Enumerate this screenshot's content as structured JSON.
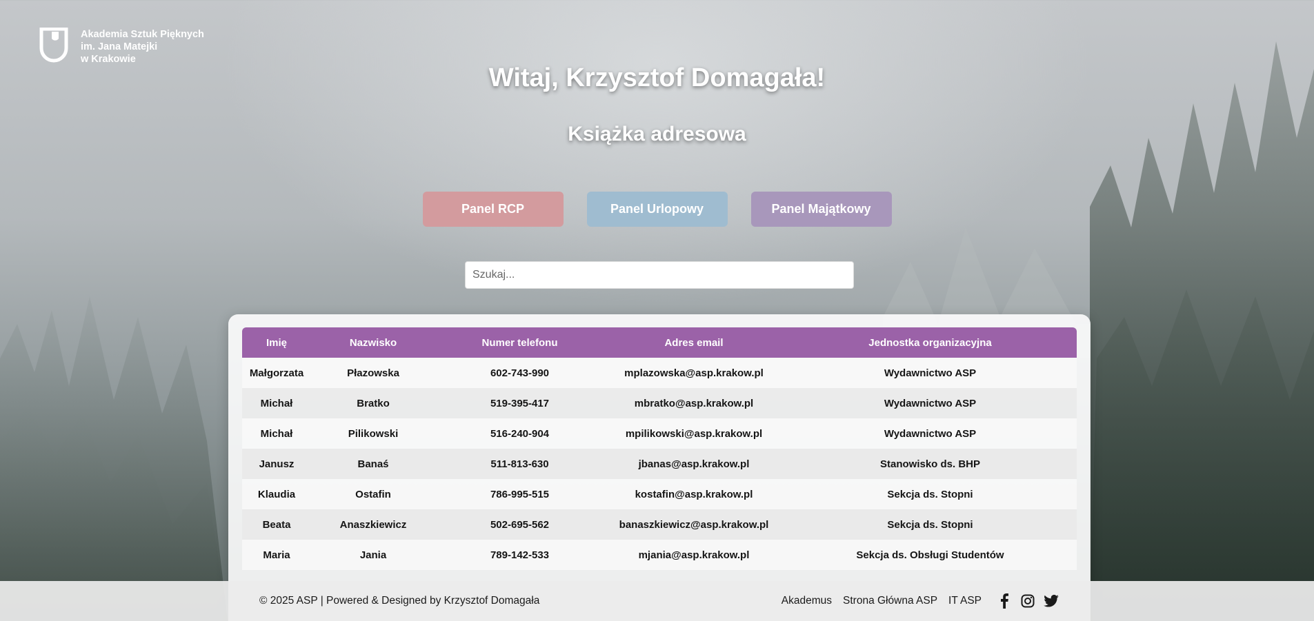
{
  "logo": {
    "lines": [
      "Akademia Sztuk Pięknych",
      "im. Jana Matejki",
      "w Krakowie"
    ]
  },
  "header": {
    "welcome": "Witaj, Krzysztof Domagała!",
    "subtitle": "Książka adresowa"
  },
  "panels": [
    {
      "label": "Panel RCP",
      "color": "#d39b9e"
    },
    {
      "label": "Panel Urlopowy",
      "color": "#9fbcd0"
    },
    {
      "label": "Panel Majątkowy",
      "color": "#a897bb"
    }
  ],
  "search": {
    "placeholder": "Szukaj..."
  },
  "table": {
    "headers": [
      "Imię",
      "Nazwisko",
      "Numer telefonu",
      "Adres email",
      "Jednostka organizacyjna"
    ],
    "rows": [
      [
        "Małgorzata",
        "Płazowska",
        "602-743-990",
        "mplazowska@asp.krakow.pl",
        "Wydawnictwo ASP"
      ],
      [
        "Michał",
        "Bratko",
        "519-395-417",
        "mbratko@asp.krakow.pl",
        "Wydawnictwo ASP"
      ],
      [
        "Michał",
        "Pilikowski",
        "516-240-904",
        "mpilikowski@asp.krakow.pl",
        "Wydawnictwo ASP"
      ],
      [
        "Janusz",
        "Banaś",
        "511-813-630",
        "jbanas@asp.krakow.pl",
        "Stanowisko ds. BHP"
      ],
      [
        "Klaudia",
        "Ostafin",
        "786-995-515",
        "kostafin@asp.krakow.pl",
        "Sekcja ds. Stopni"
      ],
      [
        "Beata",
        "Anaszkiewicz",
        "502-695-562",
        "banaszkiewicz@asp.krakow.pl",
        "Sekcja ds. Stopni"
      ],
      [
        "Maria",
        "Jania",
        "789-142-533",
        "mjania@asp.krakow.pl",
        "Sekcja ds. Obsługi Studentów"
      ]
    ],
    "header_color": "#9b62a8"
  },
  "footer": {
    "copyright": "© 2025 ASP | Powered & Designed by Krzysztof Domagała",
    "links": [
      "Akademus",
      "Strona Główna ASP",
      "IT ASP"
    ],
    "social_icons": [
      "facebook-icon",
      "instagram-icon",
      "twitter-icon"
    ]
  }
}
